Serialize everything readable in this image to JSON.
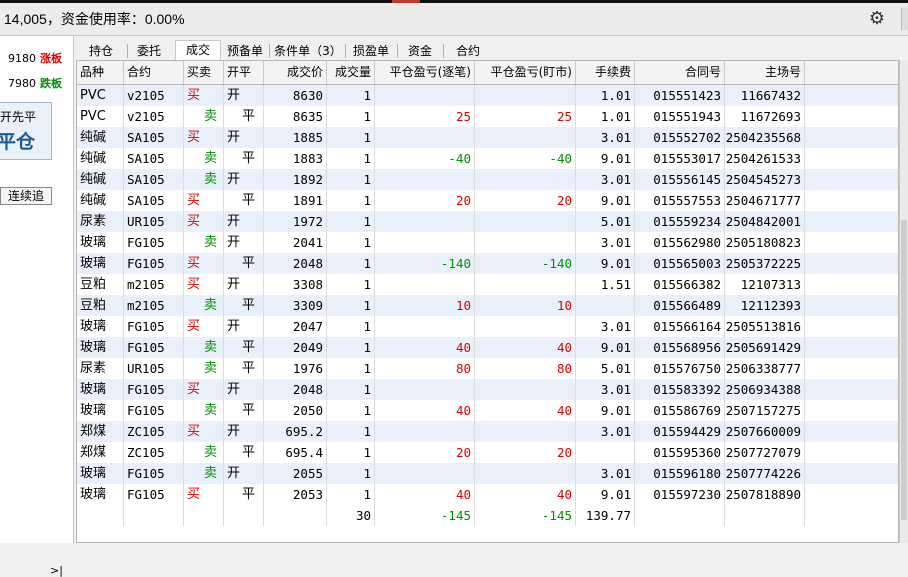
{
  "topbar": {
    "title": "14,005，资金使用率：0.00%",
    "gear_icon": "gear-icon"
  },
  "left_panel": {
    "quotes": [
      {
        "price": "9180",
        "label": "涨板",
        "color": "#e00000"
      },
      {
        "price": "7980",
        "label": "跌板",
        "color": "#009000"
      }
    ],
    "box_line1": "开先平",
    "box_line2": "平仓",
    "chase_button": "连续追",
    "collapse_arrow": ">|"
  },
  "tabs": [
    {
      "label": "持仓",
      "active": false
    },
    {
      "label": "委托",
      "active": false
    },
    {
      "label": "成交",
      "active": true
    },
    {
      "label": "预备单",
      "active": false
    },
    {
      "label": "条件单（3）",
      "active": false
    },
    {
      "label": "损盈单",
      "active": false
    },
    {
      "label": "资金",
      "active": false
    },
    {
      "label": "合约",
      "active": false
    }
  ],
  "table": {
    "columns": [
      "品种",
      "合约",
      "买卖",
      "开平",
      "成交价",
      "成交量",
      "平仓盈亏(逐笔)",
      "平仓盈亏(盯市)",
      "手续费",
      "合同号",
      "主场号"
    ],
    "rows": [
      [
        "PVC",
        "v2105",
        "买",
        "开",
        "8630",
        "1",
        "",
        "",
        "1.01",
        "015551423",
        "11667432"
      ],
      [
        "PVC",
        "v2105",
        "卖",
        "平",
        "8635",
        "1",
        "25",
        "25",
        "1.01",
        "015551943",
        "11672693"
      ],
      [
        "纯碱",
        "SA105",
        "买",
        "开",
        "1885",
        "1",
        "",
        "",
        "3.01",
        "015552702",
        "2504235568"
      ],
      [
        "纯碱",
        "SA105",
        "卖",
        "平",
        "1883",
        "1",
        "-40",
        "-40",
        "9.01",
        "015553017",
        "2504261533"
      ],
      [
        "纯碱",
        "SA105",
        "卖",
        "开",
        "1892",
        "1",
        "",
        "",
        "3.01",
        "015556145",
        "2504545273"
      ],
      [
        "纯碱",
        "SA105",
        "买",
        "平",
        "1891",
        "1",
        "20",
        "20",
        "9.01",
        "015557553",
        "2504671777"
      ],
      [
        "尿素",
        "UR105",
        "买",
        "开",
        "1972",
        "1",
        "",
        "",
        "5.01",
        "015559234",
        "2504842001"
      ],
      [
        "玻璃",
        "FG105",
        "卖",
        "开",
        "2041",
        "1",
        "",
        "",
        "3.01",
        "015562980",
        "2505180823"
      ],
      [
        "玻璃",
        "FG105",
        "买",
        "平",
        "2048",
        "1",
        "-140",
        "-140",
        "9.01",
        "015565003",
        "2505372225"
      ],
      [
        "豆粕",
        "m2105",
        "买",
        "开",
        "3308",
        "1",
        "",
        "",
        "1.51",
        "015566382",
        "12107313"
      ],
      [
        "豆粕",
        "m2105",
        "卖",
        "平",
        "3309",
        "1",
        "10",
        "10",
        "",
        "015566489",
        "12112393"
      ],
      [
        "玻璃",
        "FG105",
        "买",
        "开",
        "2047",
        "1",
        "",
        "",
        "3.01",
        "015566164",
        "2505513816"
      ],
      [
        "玻璃",
        "FG105",
        "卖",
        "平",
        "2049",
        "1",
        "40",
        "40",
        "9.01",
        "015568956",
        "2505691429"
      ],
      [
        "尿素",
        "UR105",
        "卖",
        "平",
        "1976",
        "1",
        "80",
        "80",
        "5.01",
        "015576750",
        "2506338777"
      ],
      [
        "玻璃",
        "FG105",
        "买",
        "开",
        "2048",
        "1",
        "",
        "",
        "3.01",
        "015583392",
        "2506934388"
      ],
      [
        "玻璃",
        "FG105",
        "卖",
        "平",
        "2050",
        "1",
        "40",
        "40",
        "9.01",
        "015586769",
        "2507157275"
      ],
      [
        "郑煤",
        "ZC105",
        "买",
        "开",
        "695.2",
        "1",
        "",
        "",
        "3.01",
        "015594429",
        "2507660009"
      ],
      [
        "郑煤",
        "ZC105",
        "卖",
        "平",
        "695.4",
        "1",
        "20",
        "20",
        "",
        "015595360",
        "2507727079"
      ],
      [
        "玻璃",
        "FG105",
        "卖",
        "开",
        "2055",
        "1",
        "",
        "",
        "3.01",
        "015596180",
        "2507774226"
      ],
      [
        "玻璃",
        "FG105",
        "买",
        "平",
        "2053",
        "1",
        "40",
        "40",
        "9.01",
        "015597230",
        "2507818890"
      ]
    ],
    "totals": {
      "volume": "30",
      "pnl_each": "-145",
      "pnl_mark": "-145",
      "fee": "139.77"
    }
  },
  "colors": {
    "buy": "#e00000",
    "sell": "#009000",
    "row_alt": "#e8f0fb"
  }
}
